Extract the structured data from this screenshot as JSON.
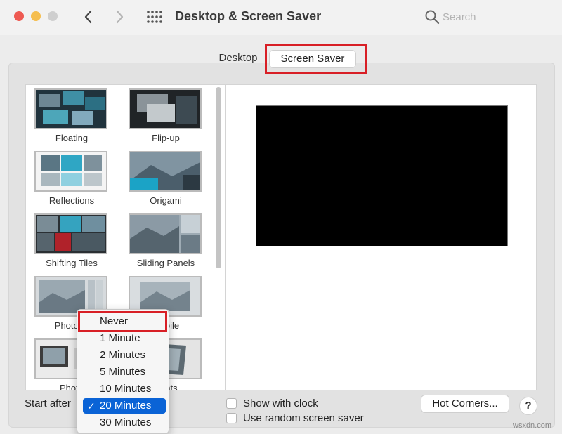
{
  "window": {
    "title": "Desktop & Screen Saver",
    "search_placeholder": "Search"
  },
  "tabs": [
    {
      "label": "Desktop",
      "selected": false
    },
    {
      "label": "Screen Saver",
      "selected": true
    }
  ],
  "screen_savers": [
    {
      "label": "Floating"
    },
    {
      "label": "Flip-up"
    },
    {
      "label": "Reflections"
    },
    {
      "label": "Origami"
    },
    {
      "label": "Shifting Tiles"
    },
    {
      "label": "Sliding Panels"
    },
    {
      "label": "Photo M"
    },
    {
      "label": "Mobile"
    },
    {
      "label": "Photo"
    },
    {
      "label": "Prints"
    }
  ],
  "bottom": {
    "start_after_label": "Start after",
    "show_clock_label": "Show with clock",
    "random_saver_label": "Use random screen saver",
    "hot_corners_label": "Hot Corners...",
    "help_label": "?"
  },
  "start_after_menu": {
    "options": [
      "Never",
      "1 Minute",
      "2 Minutes",
      "5 Minutes",
      "10 Minutes",
      "20 Minutes",
      "30 Minutes"
    ],
    "selected": "20 Minutes",
    "check_glyph": "✓"
  },
  "watermark": "wsxdn.com",
  "colors": {
    "highlight_box": "#d81f26",
    "selection": "#0a63d6"
  }
}
